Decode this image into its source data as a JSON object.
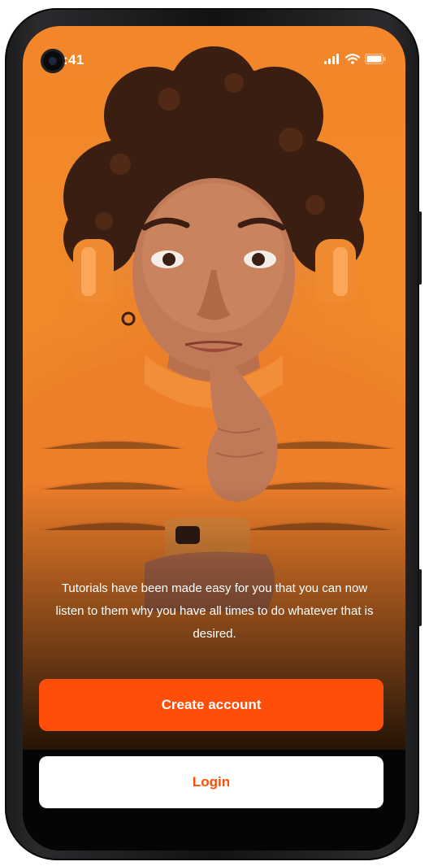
{
  "status_bar": {
    "time": ":41"
  },
  "onboarding": {
    "caption": "Tutorials have been made easy for you that you can now listen to them why you have all times to do whatever that is desired.",
    "create_account_label": "Create account",
    "login_label": "Login"
  },
  "icons": {
    "signal": "cellular-signal-icon",
    "wifi": "wifi-icon",
    "battery": "battery-icon",
    "camera": "front-camera-icon"
  },
  "colors": {
    "accent": "#ff4d0a",
    "hero_orange": "#f08a2a",
    "button_text_light": "#ffffff"
  }
}
